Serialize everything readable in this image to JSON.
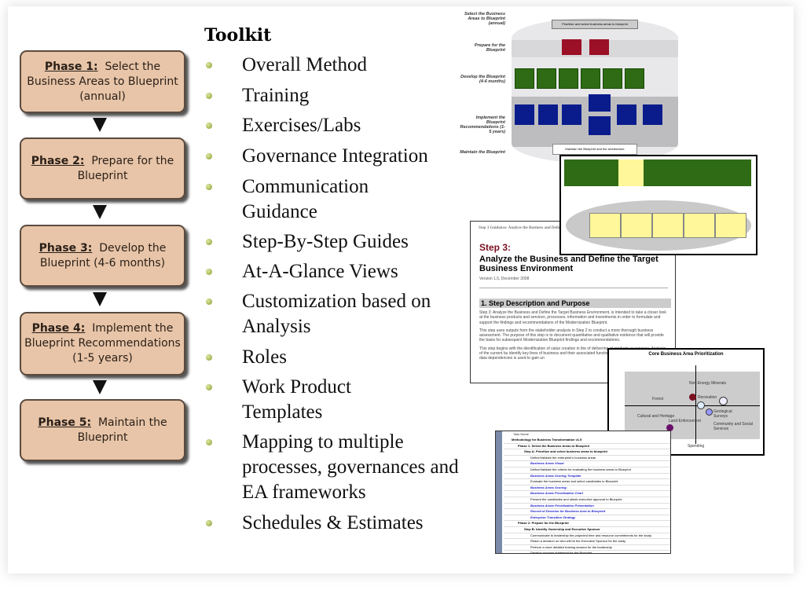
{
  "phases": [
    {
      "label": "Phase 1:",
      "text": "Select the Business Areas to Blueprint (annual)"
    },
    {
      "label": "Phase 2:",
      "text": "Prepare for the Blueprint"
    },
    {
      "label": "Phase 3:",
      "text": "Develop the Blueprint (4-6 months)"
    },
    {
      "label": "Phase 4:",
      "text": "Implement the Blueprint Recommendations (1-5 years)"
    },
    {
      "label": "Phase 5:",
      "text": "Maintain the Blueprint"
    }
  ],
  "toolkit": {
    "title": "Toolkit",
    "items": [
      "Overall Method",
      "Training",
      "Exercises/Labs",
      "Governance Integration",
      "Communication Guidance",
      "Step-By-Step Guides",
      "At-A-Glance Views",
      "Customization based on Analysis",
      "Roles",
      "Work Product Templates",
      "Mapping to multiple processes, governances and EA frameworks",
      "Schedules & Estimates"
    ]
  },
  "process_thumb": {
    "lanes": [
      "Select the Business Areas to Blueprint (annual)",
      "Prepare for the Blueprint",
      "Develop the Blueprint (4-6 months)",
      "Implement the Blueprint Recommendations (1-5 years)",
      "Maintain the Blueprint"
    ],
    "top_box": "Prioritize and select business areas to blueprint",
    "bottom_box": "Maintain the Blueprint and the architecture"
  },
  "doc_thumb": {
    "header": "Step 3 Guidance: Analyze the Business and Define the Target",
    "step": "Step 3:",
    "title": "Analyze the Business and Define the Target Business Environment",
    "version": "Version 1.5, December 2008",
    "section": "1. Step Description and Purpose",
    "para1": "Step 3: Analyze the Business and Define the Target Business Environment, is intended to take a closer look at the business products and services, processes, information and investments in order to formulate and support the findings and recommendations of the Modernization Blueprint.",
    "para2": "This step uses outputs from the stakeholder analysis in Step 2 to conduct a more thorough business assessment. The purpose of this step is to document quantitative and qualitative evidence that will provide the basis for subsequent Modernization Blueprint findings and recommendations.",
    "para3": "This step begins with the identification of value creation in the of delivering of products or services. Analysis of the current bu identify key lines of business and their associated functions an information sources and data dependencies is used to gain un"
  },
  "chart_thumb": {
    "title": "Core Business Area Prioritization",
    "x_label": "Spending",
    "labels": [
      "Non-Energy Minerals",
      "Forest",
      "Recreation",
      "Geological Surveys",
      "Landscape and Watersheds",
      "Energy",
      "Cultural and Heritage",
      "Land Enforcement",
      "Wildland Fire",
      "Community and Social Services",
      "Trust Consultation and Services"
    ]
  },
  "table_thumb": {
    "header": "Task Name",
    "rows": [
      "Methodology for Business Transformation v1.5",
      "Phase 1: Select the Business Areas to Blueprint",
      "Step A: Prioritize and select business areas to blueprint",
      "Define/Validate the enterprise's business areas",
      "Business Areas Visual",
      "Define/Validate the criteria for evaluating the business areas to Blueprint",
      "Business Areas Scoring Template",
      "Evaluate the business areas and select candidates to Blueprint",
      "Business Areas Scoring",
      "Business Areas Prioritization Chart",
      "Present the candidates and obtain executive approval to Blueprint",
      "Business Areas Prioritization Presentation",
      "Record of Decision for Business Area to Blueprint",
      "Enterprise Transition Strategy",
      "Phase 2: Prepare for the Blueprint",
      "Step B: Identify Ownership and Executive Sponsor",
      "Communicate to leadership the projected time and resource commitments for the study",
      "Reach a decision on who will be the Executive Sponsor for the study",
      "Perform a more detailed training session for the leadership",
      "Develop purpose statement for the Blueprint",
      "Blueprint Purpose Statement",
      "Step C: Form the Core Team"
    ]
  }
}
